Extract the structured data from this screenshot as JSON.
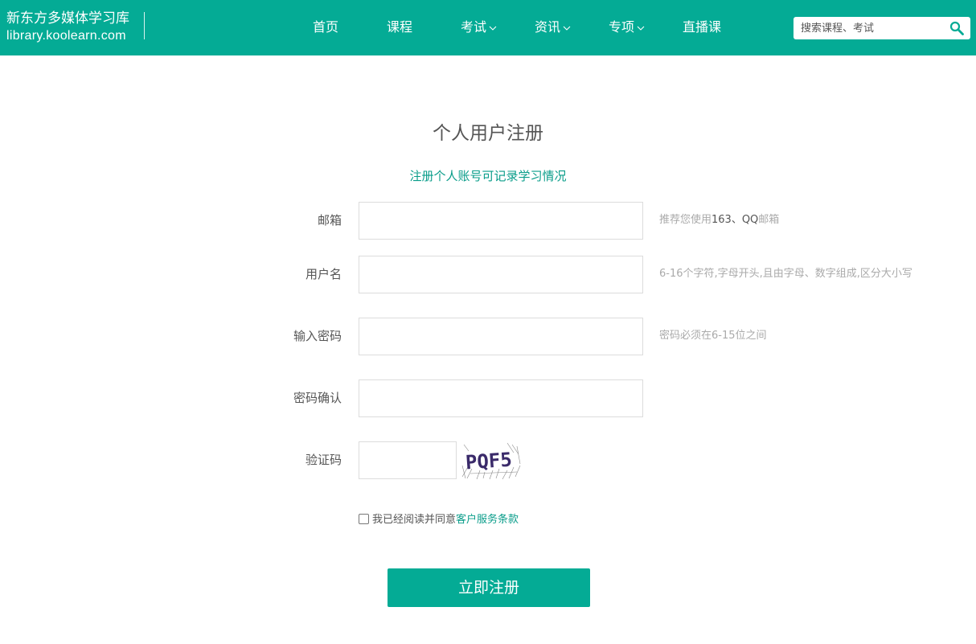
{
  "header": {
    "brand_name": "新东方多媒体学习库",
    "brand_url": "library.koolearn.com",
    "nav": [
      {
        "label": "首页",
        "has_dropdown": false
      },
      {
        "label": "课程",
        "has_dropdown": false
      },
      {
        "label": "考试",
        "has_dropdown": true
      },
      {
        "label": "资讯",
        "has_dropdown": true
      },
      {
        "label": "专项",
        "has_dropdown": true
      },
      {
        "label": "直播课",
        "has_dropdown": false
      }
    ],
    "search_placeholder": "搜索课程、考试",
    "search_icon": "search-icon",
    "bg_color": "#04ab95"
  },
  "form": {
    "title": "个人用户注册",
    "subtitle": "注册个人账号可记录学习情况",
    "email": {
      "label": "邮箱",
      "value": "",
      "hint_prefix": "推荐您使用",
      "hint_highlight": "163、QQ",
      "hint_suffix": "邮箱"
    },
    "username": {
      "label": "用户名",
      "value": "",
      "hint": "6-16个字符,字母开头,且由字母、数字组成,区分大小写"
    },
    "password": {
      "label": "输入密码",
      "value": "",
      "hint": "密码必须在6-15位之间"
    },
    "confirm": {
      "label": "密码确认",
      "value": ""
    },
    "captcha": {
      "label": "验证码",
      "value": "",
      "image_text": "PQF5"
    },
    "agree": {
      "checked": false,
      "text": "我已经阅读并同意",
      "link": "客户服务条款"
    },
    "submit_label": "立即注册",
    "accent_color": "#0a9d8a"
  }
}
